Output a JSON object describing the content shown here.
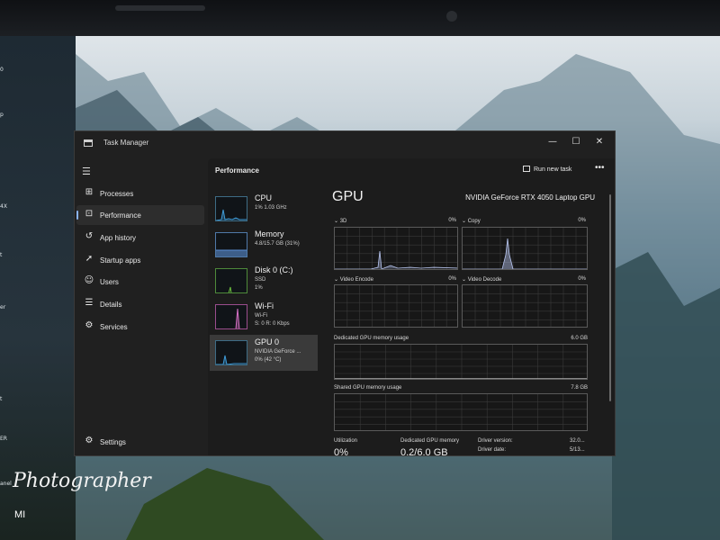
{
  "desktop": {
    "watermark": "Photographer",
    "watermark_sub": "MI",
    "left_icon_fragments": [
      "0",
      "p",
      "4X",
      "t",
      "er",
      "t",
      "ER",
      "anel"
    ]
  },
  "window": {
    "title": "Task Manager",
    "controls": {
      "minimize": "—",
      "maximize": "☐",
      "close": "✕"
    }
  },
  "nav": {
    "menu_icon": "hamburger-icon",
    "items": [
      {
        "label": "Processes",
        "icon": "processes-icon",
        "glyph": "⊞"
      },
      {
        "label": "Performance",
        "icon": "performance-icon",
        "glyph": "⊡",
        "active": true
      },
      {
        "label": "App history",
        "icon": "history-icon",
        "glyph": "↺"
      },
      {
        "label": "Startup apps",
        "icon": "startup-icon",
        "glyph": "➚"
      },
      {
        "label": "Users",
        "icon": "users-icon",
        "glyph": "☺"
      },
      {
        "label": "Details",
        "icon": "details-icon",
        "glyph": "☰"
      },
      {
        "label": "Services",
        "icon": "services-icon",
        "glyph": "⚙"
      }
    ],
    "settings": {
      "label": "Settings",
      "glyph": "⚙"
    }
  },
  "header": {
    "title": "Performance",
    "run_new_task": "Run new task",
    "more": "•••"
  },
  "devices": [
    {
      "name": "CPU",
      "line1": "1% 1.03 GHz",
      "line2": "",
      "kind": "cpu"
    },
    {
      "name": "Memory",
      "line1": "4.8/15.7 GB (31%)",
      "line2": "",
      "kind": "mem"
    },
    {
      "name": "Disk 0 (C:)",
      "line1": "SSD",
      "line2": "1%",
      "kind": "disk"
    },
    {
      "name": "Wi-Fi",
      "line1": "Wi-Fi",
      "line2": "S: 0 R: 0 Kbps",
      "kind": "wifi"
    },
    {
      "name": "GPU 0",
      "line1": "NVIDIA GeForce ...",
      "line2": "0% (42 °C)",
      "kind": "gpu",
      "selected": true
    }
  ],
  "gpu": {
    "title": "GPU",
    "model": "NVIDIA GeForce RTX 4050 Laptop GPU",
    "engines": [
      {
        "label": "3D",
        "pct": "0%"
      },
      {
        "label": "Copy",
        "pct": "0%"
      },
      {
        "label": "Video Encode",
        "pct": "0%"
      },
      {
        "label": "Video Decode",
        "pct": "0%"
      }
    ],
    "dedicated_label": "Dedicated GPU memory usage",
    "dedicated_max": "6.0 GB",
    "shared_label": "Shared GPU memory usage",
    "shared_max": "7.8 GB",
    "stats": {
      "utilization_label": "Utilization",
      "utilization_value": "0%",
      "dedicated_mem_label": "Dedicated GPU memory",
      "dedicated_mem_value": "0.2/6.0 GB",
      "driver_version_label": "Driver version:",
      "driver_version_value": "32.0...",
      "driver_date_label": "Driver date:",
      "driver_date_value": "5/13..."
    }
  },
  "colors": {
    "cpu": "#3e9ad6",
    "mem": "#5b8fd6",
    "disk": "#6cbf3e",
    "wifi": "#d46fc4",
    "gpu": "#3e9ad6",
    "gpu_graph_line": "#b8c6f0"
  }
}
